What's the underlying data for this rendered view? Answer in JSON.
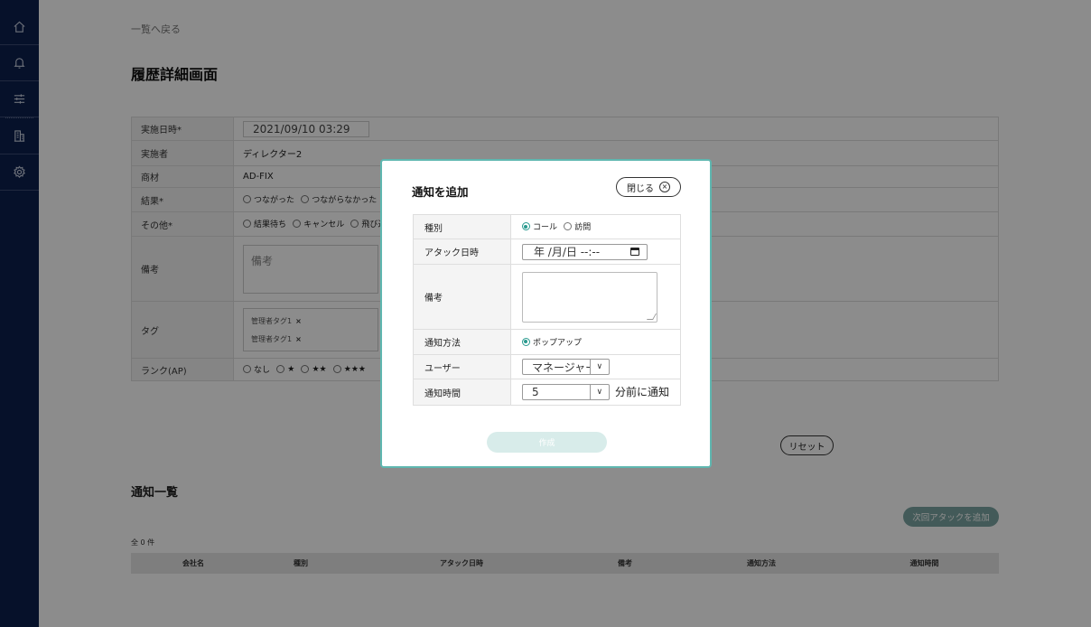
{
  "sidebar": {
    "items": [
      "home-icon",
      "bell-icon",
      "sliders-icon",
      "building-icon",
      "gear-icon"
    ]
  },
  "page": {
    "back_link": "一覧へ戻る",
    "title": "履歴詳細画面"
  },
  "form": {
    "date_label": "実施日時*",
    "date_value": "2021/09/10 03:29",
    "person_label": "実施者",
    "person_value": "ディレクター2",
    "product_label": "商材",
    "product_value": "AD-FIX",
    "result_label": "結果*",
    "result_options": [
      "つながった",
      "つながらなかった"
    ],
    "other_label": "その他*",
    "other_options": [
      "結果待ち",
      "キャンセル",
      "飛び込"
    ],
    "memo_label": "備考",
    "memo_placeholder": "備考",
    "tag_label": "タグ",
    "tags": [
      "管理者タグ1",
      "管理者タグ1"
    ],
    "tag_remove": "×",
    "rank_label": "ランク(AP)",
    "rank_options": [
      "なし",
      "★",
      "★★",
      "★★★"
    ]
  },
  "reset_label": "リセット",
  "notifications": {
    "title": "通知一覧",
    "add_next_label": "次回アタックを追加",
    "count": "全 0 件",
    "columns": [
      "会社名",
      "種別",
      "アタック日時",
      "備考",
      "通知方法",
      "通知時間"
    ]
  },
  "modal": {
    "title": "通知を追加",
    "close_label": "閉じる",
    "close_icon": "×",
    "type_label": "種別",
    "type_options": [
      "コール",
      "訪問"
    ],
    "attack_label": "アタック日時",
    "attack_value": "年 /月/日 --:--",
    "memo_label": "備考",
    "method_label": "通知方法",
    "method_option": "ポップアップ",
    "user_label": "ユーザー",
    "user_value": "マネージャー",
    "time_label": "通知時間",
    "time_value": "5",
    "time_suffix": "分前に通知",
    "chevron": "∨",
    "create_label": "作成"
  },
  "colors": {
    "sidebar": "#0b1f4d",
    "accent": "#5fb7b0",
    "radio_on": "#2a9a8f"
  }
}
